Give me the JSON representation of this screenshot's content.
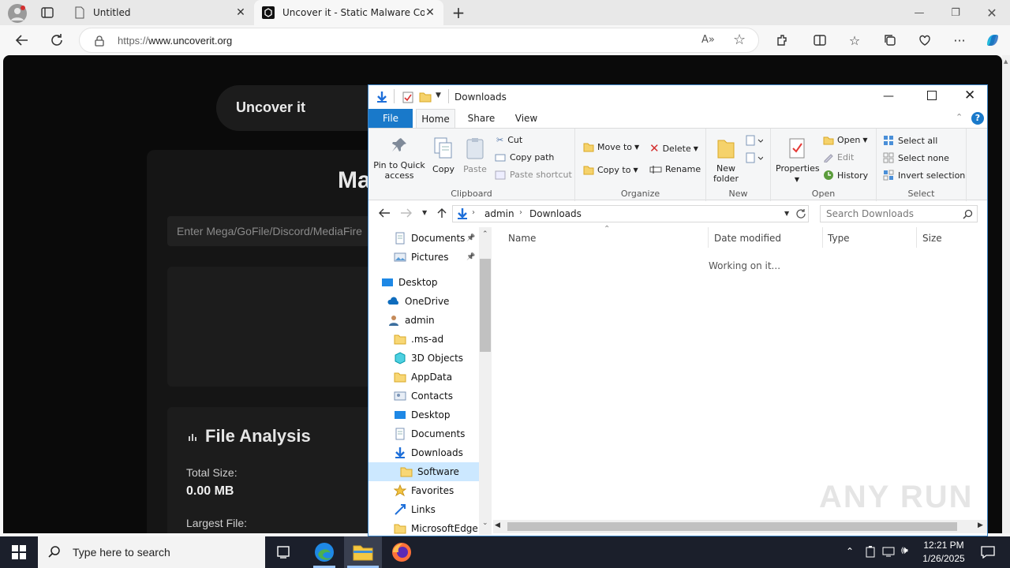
{
  "browser": {
    "tabs": [
      {
        "title": "Untitled"
      },
      {
        "title": "Uncover it - Static Malware Confi"
      }
    ],
    "url_prefix": "https://",
    "url_host": "www.uncoverit.org"
  },
  "website": {
    "logo": "Uncover it",
    "heading": "Ma",
    "input_placeholder": "Enter Mega/GoFile/Discord/MediaFire",
    "section_title": "File Analysis",
    "total_size_label": "Total Size:",
    "total_size_value": "0.00 MB",
    "largest_file_label": "Largest File:"
  },
  "explorer": {
    "title": "Downloads",
    "ribbon_tabs": [
      "File",
      "Home",
      "Share",
      "View"
    ],
    "clipboard": {
      "pin": "Pin to Quick access",
      "pin_l1": "Pin to Quick",
      "pin_l2": "access",
      "copy": "Copy",
      "paste": "Paste",
      "cut": "Cut",
      "copy_path": "Copy path",
      "paste_shortcut": "Paste shortcut",
      "group": "Clipboard"
    },
    "organize": {
      "move_to": "Move to",
      "copy_to": "Copy to",
      "delete": "Delete",
      "rename": "Rename",
      "group": "Organize"
    },
    "new": {
      "new_folder_l1": "New",
      "new_folder_l2": "folder",
      "group": "New"
    },
    "open": {
      "properties": "Properties",
      "open": "Open",
      "edit": "Edit",
      "history": "History",
      "group": "Open"
    },
    "select": {
      "select_all": "Select all",
      "select_none": "Select none",
      "invert": "Invert selection",
      "group": "Select"
    },
    "path": [
      "admin",
      "Downloads"
    ],
    "search_placeholder": "Search Downloads",
    "nav_items": [
      {
        "label": "Documents",
        "icon": "documents-icon",
        "pinned": true
      },
      {
        "label": "Pictures",
        "icon": "pictures-icon",
        "pinned": true
      },
      {
        "label": "Desktop",
        "icon": "desktop-icon"
      },
      {
        "label": "OneDrive",
        "icon": "onedrive-icon"
      },
      {
        "label": "admin",
        "icon": "user-icon"
      },
      {
        "label": ".ms-ad",
        "icon": "folder-icon"
      },
      {
        "label": "3D Objects",
        "icon": "3d-objects-icon"
      },
      {
        "label": "AppData",
        "icon": "folder-icon"
      },
      {
        "label": "Contacts",
        "icon": "contacts-icon"
      },
      {
        "label": "Desktop",
        "icon": "desktop-icon"
      },
      {
        "label": "Documents",
        "icon": "documents-icon"
      },
      {
        "label": "Downloads",
        "icon": "downloads-icon"
      },
      {
        "label": "Software",
        "icon": "folder-icon",
        "selected": true
      },
      {
        "label": "Favorites",
        "icon": "favorites-icon"
      },
      {
        "label": "Links",
        "icon": "links-icon"
      },
      {
        "label": "MicrosoftEdge",
        "icon": "folder-icon"
      }
    ],
    "columns": [
      "Name",
      "Date modified",
      "Type",
      "Size"
    ],
    "status_message": "Working on it..."
  },
  "taskbar": {
    "search_placeholder": "Type here to search",
    "time": "12:21 PM",
    "date": "1/26/2025"
  },
  "watermark": "ANY RUN"
}
